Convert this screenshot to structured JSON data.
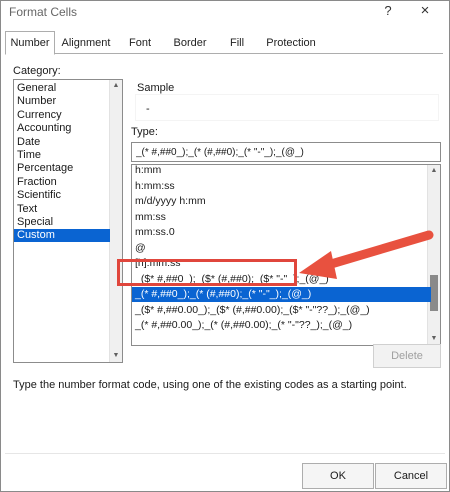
{
  "window": {
    "title": "Format Cells",
    "help_icon": "?",
    "close_icon": "×"
  },
  "tabs": [
    {
      "label": "Number",
      "active": true
    },
    {
      "label": "Alignment",
      "active": false
    },
    {
      "label": "Font",
      "active": false
    },
    {
      "label": "Border",
      "active": false
    },
    {
      "label": "Fill",
      "active": false
    },
    {
      "label": "Protection",
      "active": false
    }
  ],
  "category": {
    "label": "Category:",
    "items": [
      "General",
      "Number",
      "Currency",
      "Accounting",
      "Date",
      "Time",
      "Percentage",
      "Fraction",
      "Scientific",
      "Text",
      "Special",
      "Custom"
    ],
    "selected": "Custom"
  },
  "sample": {
    "label": "Sample",
    "value": "-"
  },
  "type": {
    "label": "Type:",
    "value": "_(* #,##0_);_(* (#,##0);_(* \"-\"_);_(@_)"
  },
  "format_list": {
    "items": [
      "h:mm",
      "h:mm:ss",
      "m/d/yyyy h:mm",
      "mm:ss",
      "mm:ss.0",
      "@",
      "[h]:mm:ss",
      "_($* #,##0_);_($* (#,##0);_($* \"-\"_);_(@_)",
      "_(* #,##0_);_(* (#,##0);_(* \"-\"_);_(@_)",
      "_($* #,##0.00_);_($* (#,##0.00);_($* \"-\"??_);_(@_)",
      "_(* #,##0.00_);_(* (#,##0.00);_(* \"-\"??_);_(@_)"
    ],
    "selected_index": 8,
    "scroll_position": 0.82
  },
  "buttons": {
    "delete": "Delete",
    "ok": "OK",
    "cancel": "Cancel"
  },
  "hint": "Type the number format code, using one of the existing codes as a starting point.",
  "colors": {
    "selection": "#0a64d2",
    "highlight_red": "#e0463c",
    "arrow_red": "#e8513f"
  }
}
